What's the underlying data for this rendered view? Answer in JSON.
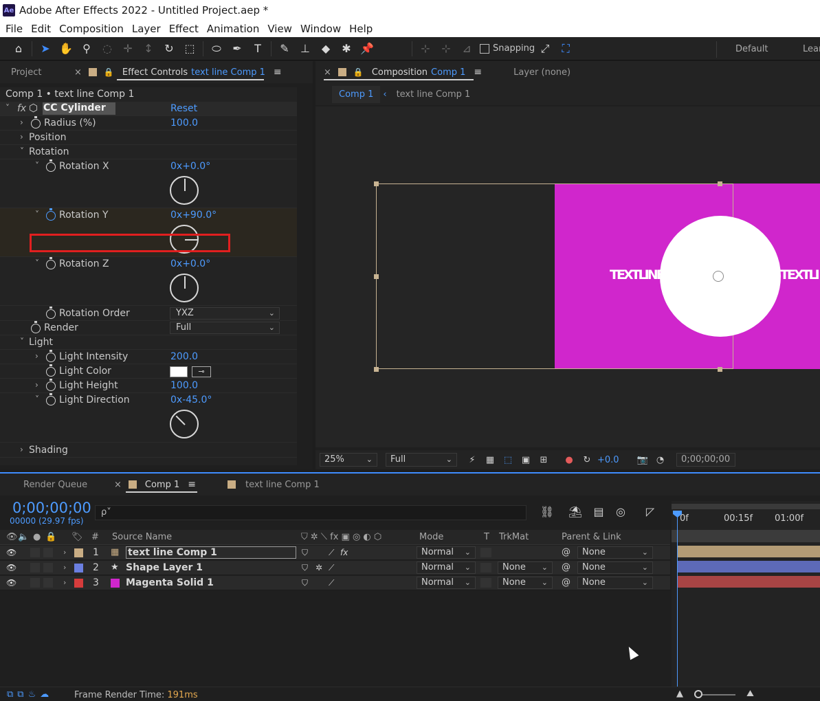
{
  "window": {
    "logo": "Ae",
    "title": "Adobe After Effects 2022 - Untitled Project.aep *"
  },
  "menu": [
    "File",
    "Edit",
    "Composition",
    "Layer",
    "Effect",
    "Animation",
    "View",
    "Window",
    "Help"
  ],
  "toolbar": {
    "snapping_label": "Snapping",
    "workspace_default": "Default",
    "workspace_learn": "Lear"
  },
  "effect_panel": {
    "tab_project": "Project",
    "tab_effect_controls": "Effect Controls",
    "tab_effect_target": "text line Comp 1",
    "breadcrumb": "Comp 1 • text line Comp 1",
    "effect_name": "CC Cylinder",
    "fx_label": "fx",
    "reset_label": "Reset",
    "props": {
      "radius": {
        "label": "Radius (%)",
        "value": "100.0"
      },
      "position": {
        "label": "Position"
      },
      "rotation": {
        "label": "Rotation"
      },
      "rotation_x": {
        "label": "Rotation X",
        "value": "0x+0.0°",
        "angle_deg": 0
      },
      "rotation_y": {
        "label": "Rotation Y",
        "value": "0x+90.0°",
        "angle_deg": 90
      },
      "rotation_z": {
        "label": "Rotation Z",
        "value": "0x+0.0°",
        "angle_deg": 0
      },
      "rotation_order": {
        "label": "Rotation Order",
        "value": "YXZ"
      },
      "render": {
        "label": "Render",
        "value": "Full"
      },
      "light": {
        "label": "Light"
      },
      "light_intensity": {
        "label": "Light Intensity",
        "value": "200.0"
      },
      "light_color": {
        "label": "Light Color",
        "color": "#ffffff"
      },
      "light_height": {
        "label": "Light Height",
        "value": "100.0"
      },
      "light_direction": {
        "label": "Light Direction",
        "value": "0x-45.0°",
        "angle_deg": -45
      },
      "shading": {
        "label": "Shading"
      }
    }
  },
  "comp_panel": {
    "tab_label": "Composition",
    "tab_target": "Comp 1",
    "tab_layer": "Layer (none)",
    "sub_comp1": "Comp 1",
    "sub_textline": "text line Comp 1",
    "cylinder_text_left": "TEXTLINE",
    "cylinder_text_right": "TEXTLI",
    "zoom": "25%",
    "resolution": "Full",
    "exposure": "+0.0",
    "timecode": "0;00;00;00",
    "colors": {
      "solid": "#d026cc",
      "frame": "#c8b493"
    }
  },
  "timeline": {
    "tab_render_queue": "Render Queue",
    "tab_comp1": "Comp 1",
    "tab_textline": "text line Comp 1",
    "timecode": "0;00;00;00",
    "fps": "00000 (29.97 fps)",
    "search_placeholder": "ρ˅",
    "headers": {
      "hash": "#",
      "source_name": "Source Name",
      "mode": "Mode",
      "t": "T",
      "trkmat": "TrkMat",
      "parent": "Parent & Link"
    },
    "ruler": {
      "t0": "0f",
      "t1": "00:15f",
      "t2": "01:00f"
    },
    "layers": [
      {
        "num": "1",
        "name": "text line Comp 1",
        "mode": "Normal",
        "trkmat": "",
        "parent": "None",
        "label_color": "#c9ad84",
        "bar_color": "#b39b75"
      },
      {
        "num": "2",
        "name": "Shape Layer 1",
        "mode": "Normal",
        "trkmat": "None",
        "parent": "None",
        "label_color": "#6b7fe0",
        "bar_color": "#5d6ab8"
      },
      {
        "num": "3",
        "name": "Magenta Solid 1",
        "mode": "Normal",
        "trkmat": "None",
        "parent": "None",
        "label_color": "#d63c3c",
        "bar_color": "#a84444"
      }
    ]
  },
  "status": {
    "render_time_label": "Frame Render Time:",
    "render_time_value": "191ms"
  }
}
